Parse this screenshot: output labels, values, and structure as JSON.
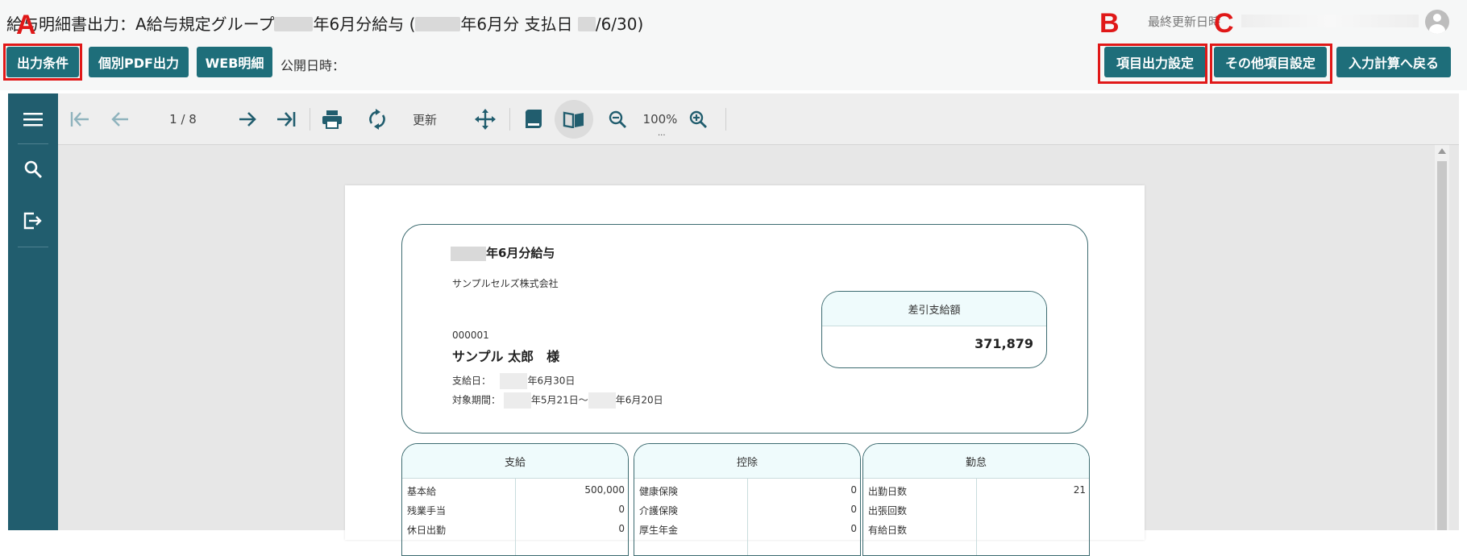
{
  "header": {
    "title_prefix": "給与明細書出力：A給与規定グループ",
    "title_month": "年6月分給与 (",
    "title_pay": "年6月分 支払日",
    "title_suffix": "/6/30)",
    "published_label": "公開日時：",
    "updated_label": "最終更新日時"
  },
  "buttons": {
    "output_conditions": "出力条件",
    "pdf_output": "個別PDF出力",
    "web_slip": "WEB明細",
    "item_output_settings": "項目出力設定",
    "other_item_settings": "その他項目設定",
    "back_to_input": "入力計算へ戻る"
  },
  "markers": {
    "a": "A",
    "b": "B",
    "c": "C"
  },
  "toolbar": {
    "page_indicator": "1 / 8",
    "refresh_label": "更新",
    "zoom": "100%",
    "zoom_dots": "..."
  },
  "icons": {
    "first": "first-page-icon",
    "prev": "prev-page-icon",
    "next": "next-page-icon",
    "last": "last-page-icon",
    "print": "print-icon",
    "refresh": "refresh-icon",
    "move": "move-icon",
    "scroll": "continuous-scroll-icon",
    "book": "book-view-icon",
    "zoom_out": "zoom-out-icon",
    "zoom_in": "zoom-in-icon",
    "menu": "menu-icon",
    "search": "search-icon",
    "export": "export-icon",
    "account": "account-icon"
  },
  "colors": {
    "accent": "#1e6e7a",
    "sidebar": "#215d6e",
    "highlight": "#e01818"
  },
  "document": {
    "title": "年6月分給与",
    "company": "サンプルセルズ株式会社",
    "employee_no": "000001",
    "employee_name": "サンプル 太郎　様",
    "pay_date_label": "支給日：",
    "pay_date": "年6月30日",
    "period_label": "対象期間：",
    "period_start": "年5月21日～",
    "period_end": "年6月20日",
    "net_pay_label": "差引支給額",
    "net_pay": "371,879"
  },
  "sections": [
    {
      "title": "支給",
      "rows": [
        {
          "label": "基本給",
          "value": "500,000"
        },
        {
          "label": "残業手当",
          "value": "0"
        },
        {
          "label": "休日出勤",
          "value": "0"
        }
      ]
    },
    {
      "title": "控除",
      "rows": [
        {
          "label": "健康保険",
          "value": "0"
        },
        {
          "label": "介護保険",
          "value": "0"
        },
        {
          "label": "厚生年金",
          "value": "0"
        }
      ]
    },
    {
      "title": "勤怠",
      "rows": [
        {
          "label": "出勤日数",
          "value": "21"
        },
        {
          "label": "出張回数",
          "value": ""
        },
        {
          "label": "有給日数",
          "value": ""
        }
      ]
    }
  ]
}
